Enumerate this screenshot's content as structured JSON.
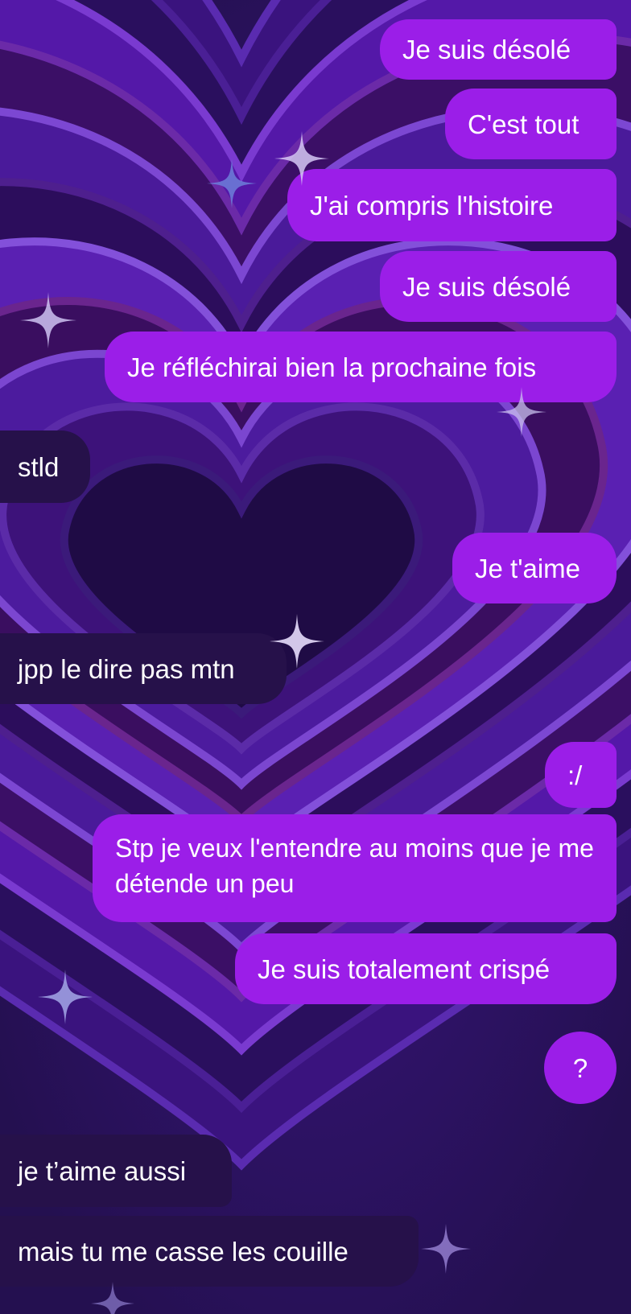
{
  "theme": {
    "outgoing_color": "#9b1ee8",
    "incoming_color": "#26114a",
    "background_color": "#2b1160",
    "background_motif": "nested-hearts",
    "decoration_icon": "sparkle-icon"
  },
  "messages": [
    {
      "direction": "outgoing",
      "text": "Je suis désolé"
    },
    {
      "direction": "outgoing",
      "text": "C'est tout"
    },
    {
      "direction": "outgoing",
      "text": "J'ai compris l'histoire"
    },
    {
      "direction": "outgoing",
      "text": "Je suis désolé"
    },
    {
      "direction": "outgoing",
      "text": "Je réfléchirai bien la prochaine fois"
    },
    {
      "direction": "incoming",
      "text": "stld"
    },
    {
      "direction": "outgoing",
      "text": "Je t'aime"
    },
    {
      "direction": "incoming",
      "text": "jpp le dire pas mtn"
    },
    {
      "direction": "outgoing",
      "text": ":/"
    },
    {
      "direction": "outgoing",
      "text": "Stp je veux l'entendre au moins que je me détende un peu"
    },
    {
      "direction": "outgoing",
      "text": "Je suis totalement crispé"
    },
    {
      "direction": "outgoing",
      "text": "?"
    },
    {
      "direction": "incoming",
      "text": "je t’aime aussi"
    },
    {
      "direction": "incoming",
      "text": "mais tu me casse les couille"
    }
  ]
}
